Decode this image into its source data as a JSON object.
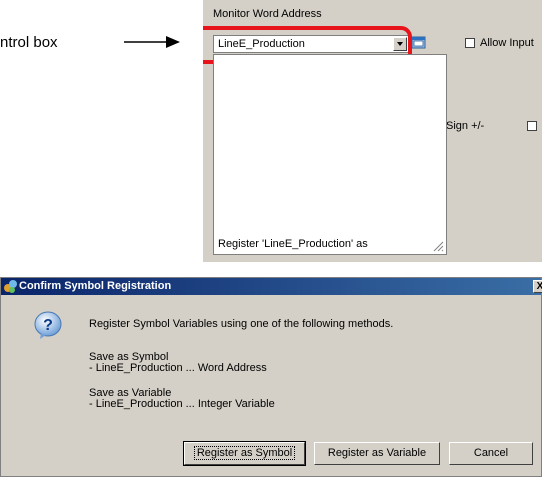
{
  "callout": {
    "text": "ntrol box"
  },
  "panel": {
    "monitor_label": "Monitor Word Address",
    "address_value": "LineE_Production",
    "allow_input_label": "Allow Input",
    "sign_label": "Sign +/-",
    "memo_text": "Register 'LineE_Production' as"
  },
  "dialog": {
    "title": "Confirm Symbol Registration",
    "message": "Register Symbol Variables using one of the following methods.",
    "symbol_heading": "Save as Symbol",
    "symbol_detail": "- LineE_Production ... Word Address",
    "variable_heading": "Save as Variable",
    "variable_detail": "- LineE_Production ... Integer Variable",
    "buttons": {
      "register_symbol": "Register as Symbol",
      "register_variable": "Register as Variable",
      "cancel": "Cancel"
    },
    "close_glyph": "X"
  },
  "colors": {
    "highlight": "#e8141b",
    "title_start": "#0a246a",
    "title_end": "#3a6ea5",
    "panel_bg": "#d4d0c8"
  },
  "icons": [
    "arrow-right-icon",
    "address-picker-icon",
    "resize-grip-icon",
    "app-icon",
    "question-icon"
  ]
}
